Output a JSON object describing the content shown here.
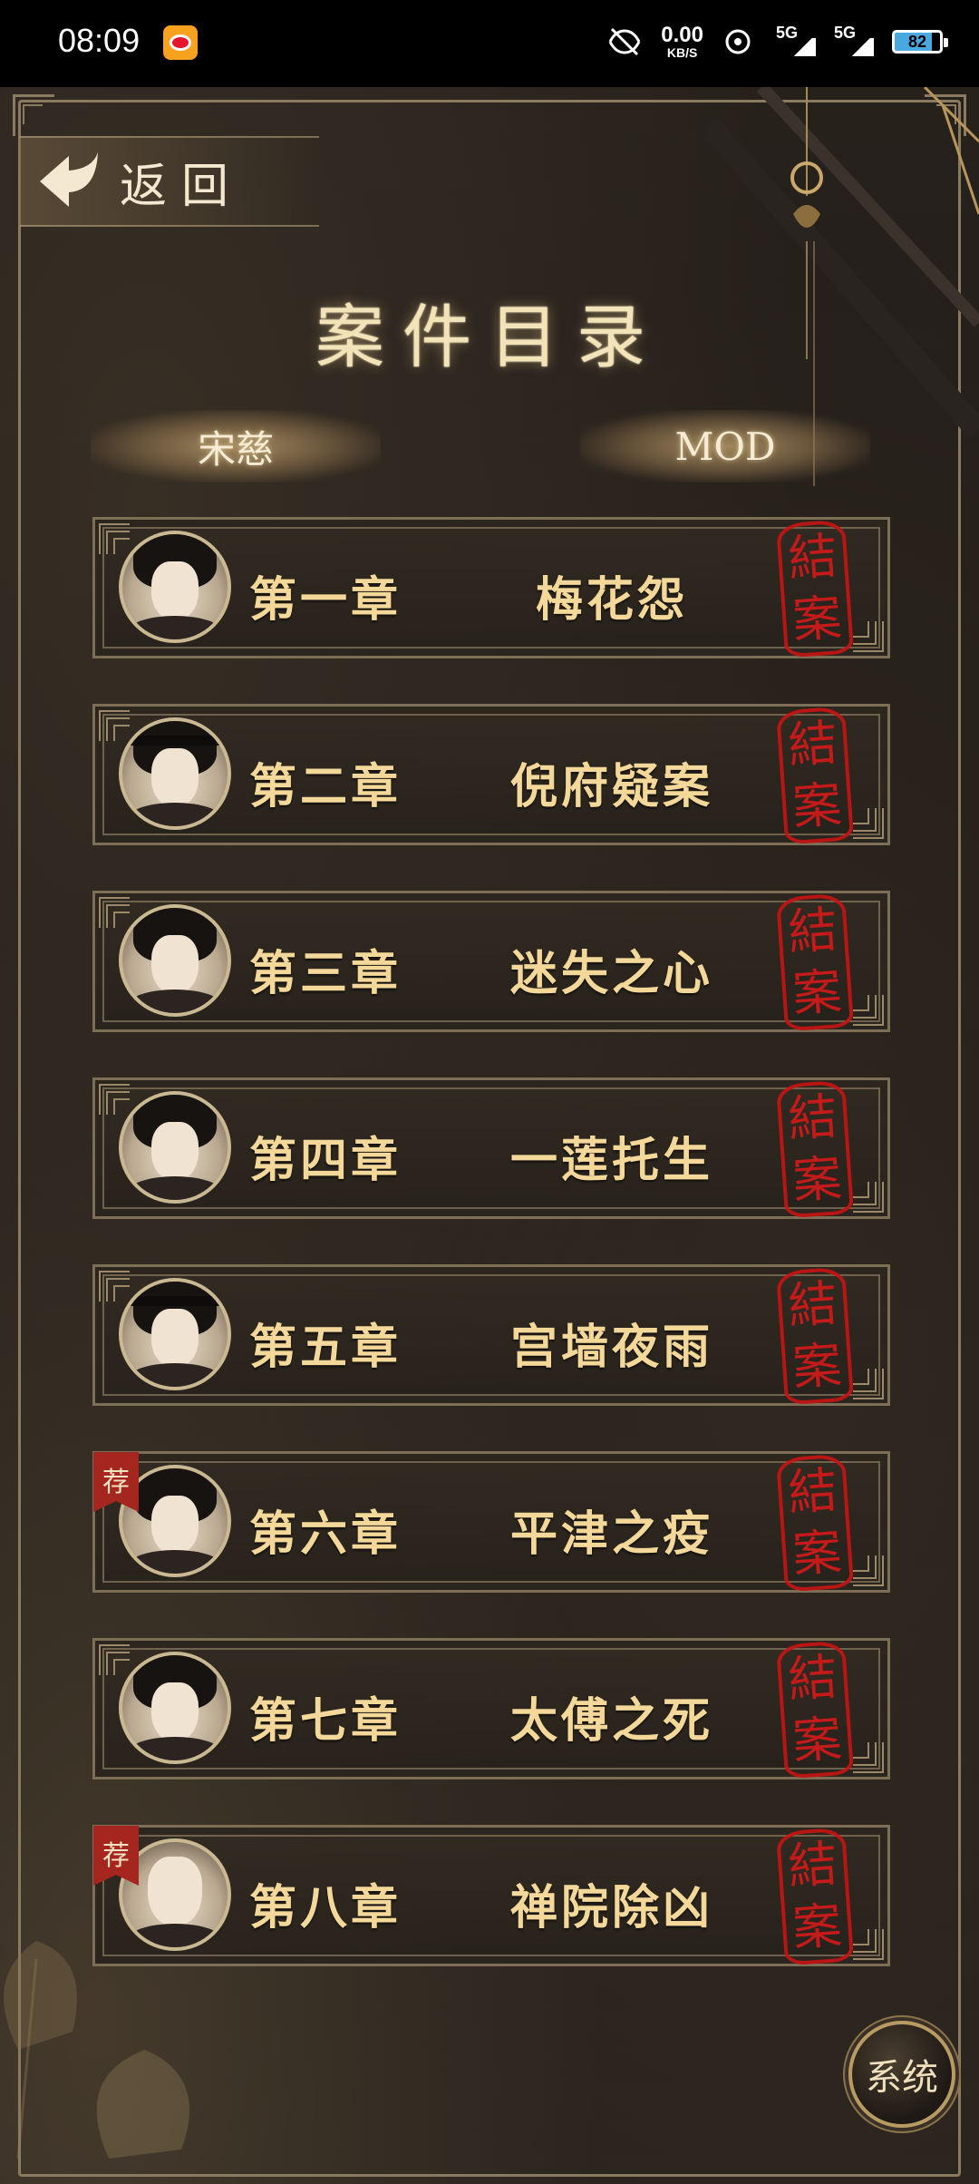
{
  "status_bar": {
    "time": "08:09",
    "net_speed_value": "0.00",
    "net_speed_unit": "KB/S",
    "signal_1": "5G",
    "signal_2": "5G",
    "battery": "82",
    "icons": [
      "weibo-icon",
      "mute-icon",
      "eye-icon",
      "signal-icon",
      "battery-icon"
    ]
  },
  "header": {
    "back_label": "返回",
    "title": "案件目录"
  },
  "tabs": [
    {
      "label": "宋慈"
    },
    {
      "label": "MOD"
    }
  ],
  "chapters": [
    {
      "number": "第一章",
      "title": "梅花怨",
      "stamp_top": "結",
      "stamp_bottom": "案",
      "recommended": false
    },
    {
      "number": "第二章",
      "title": "倪府疑案",
      "stamp_top": "結",
      "stamp_bottom": "案",
      "recommended": false
    },
    {
      "number": "第三章",
      "title": "迷失之心",
      "stamp_top": "結",
      "stamp_bottom": "案",
      "recommended": false
    },
    {
      "number": "第四章",
      "title": "一莲托生",
      "stamp_top": "結",
      "stamp_bottom": "案",
      "recommended": false
    },
    {
      "number": "第五章",
      "title": "宫墙夜雨",
      "stamp_top": "結",
      "stamp_bottom": "案",
      "recommended": false
    },
    {
      "number": "第六章",
      "title": "平津之疫",
      "stamp_top": "結",
      "stamp_bottom": "案",
      "recommended": true,
      "badge": "荐"
    },
    {
      "number": "第七章",
      "title": "太傅之死",
      "stamp_top": "結",
      "stamp_bottom": "案",
      "recommended": false
    },
    {
      "number": "第八章",
      "title": "禅院除凶",
      "stamp_top": "結",
      "stamp_bottom": "案",
      "recommended": true,
      "badge": "荐"
    }
  ],
  "system_button": {
    "label": "系统"
  },
  "colors": {
    "title_gold": "#f3e3b8",
    "chapter_text": "#f3d89a",
    "stamp_red": "#c41414",
    "badge_red": "#a5261e",
    "background": "#221d19"
  }
}
